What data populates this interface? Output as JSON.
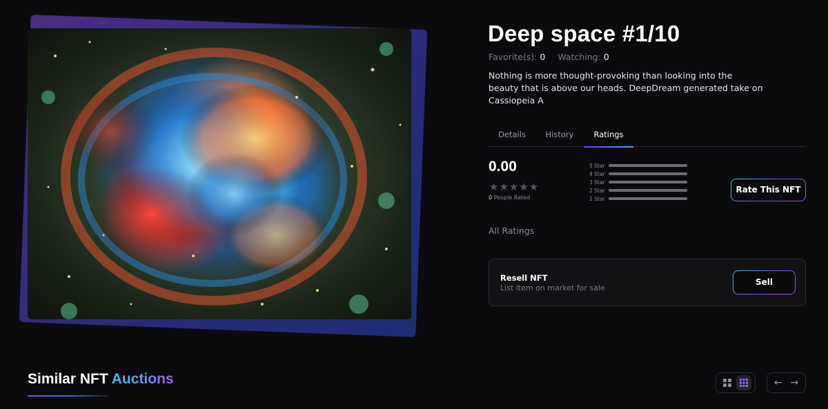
{
  "nft": {
    "title": "Deep space #1/10",
    "favorites_label": "Favorite(s):",
    "favorites_count": "0",
    "watching_label": "Watching:",
    "watching_count": "0",
    "description": "Nothing is more thought-provoking than looking into the beauty that is above our heads. DeepDream generated take on Cassiopeia A"
  },
  "tabs": [
    {
      "label": "Details",
      "active": false
    },
    {
      "label": "History",
      "active": false
    },
    {
      "label": "Ratings",
      "active": true
    }
  ],
  "ratings": {
    "average": "0.00",
    "star_icons": "★★★★★",
    "people_count": "0",
    "people_label": " People Rated",
    "bars": [
      {
        "label": "5 Star",
        "fraction": 0
      },
      {
        "label": "4 Star",
        "fraction": 0
      },
      {
        "label": "3 Star",
        "fraction": 0
      },
      {
        "label": "2 Star",
        "fraction": 0
      },
      {
        "label": "1 Star",
        "fraction": 0
      }
    ],
    "rate_button": "Rate This NFT",
    "all_ratings_label": "All Ratings"
  },
  "resell": {
    "title": "Resell NFT",
    "subtitle": "List item on market for sale",
    "button": "Sell"
  },
  "similar": {
    "title_main": "Similar NFT",
    "title_accent": "Auctions"
  },
  "controls": {
    "grid_large_icon": "grid-large-icon",
    "grid_small_icon": "grid-small-icon",
    "prev_icon": "arrow-left-icon",
    "next_icon": "arrow-right-icon",
    "prev_glyph": "←",
    "next_glyph": "→"
  },
  "colors": {
    "background": "#0b0b0d",
    "accent_cyan": "#35c6f0",
    "accent_purple": "#a05cf0"
  }
}
